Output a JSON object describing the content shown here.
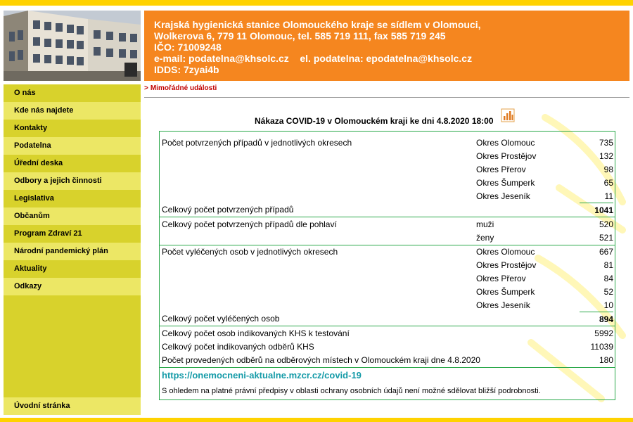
{
  "header": {
    "lines": [
      "Krajská hygienická stanice Olomouckého kraje se sídlem v Olomouci,",
      "Wolkerova 6, 779 11 Olomouc, tel. 585 719 111, fax 585 719 245",
      "IČO: 71009248",
      "e-mail: podatelna@khsolc.cz    el. podatelna: epodatelna@khsolc.cz",
      "IDDS: 7zyai4b"
    ],
    "bg_color": "#f5861f"
  },
  "sidebar": {
    "items": [
      {
        "label": "O nás"
      },
      {
        "label": "Kde nás najdete"
      },
      {
        "label": "Kontakty"
      },
      {
        "label": "Podatelna"
      },
      {
        "label": "Úřední deska"
      },
      {
        "label": "Odbory a jejich činnosti"
      },
      {
        "label": "Legislativa"
      },
      {
        "label": "Občanům"
      },
      {
        "label": "Program Zdraví 21"
      },
      {
        "label": "Národní pandemický plán"
      },
      {
        "label": "Aktuality"
      },
      {
        "label": "Odkazy"
      }
    ],
    "home_label": "Úvodní stránka"
  },
  "breadcrumb": {
    "arrow": ">",
    "label": "Mimořádné události"
  },
  "report": {
    "title": "Nákaza COVID-19 v Olomouckém kraji ke dni 4.8.2020 18:00",
    "icon": "bar-chart-icon",
    "confirmed": {
      "label": "Počet potvrzených případů v jednotlivých okresech",
      "rows": [
        {
          "district": "Okres Olomouc",
          "value": "735"
        },
        {
          "district": "Okres Prostějov",
          "value": "132"
        },
        {
          "district": "Okres Přerov",
          "value": "98"
        },
        {
          "district": "Okres Šumperk",
          "value": "65"
        },
        {
          "district": "Okres Jeseník",
          "value": "11"
        }
      ],
      "total_label": "Celkový počet potvrzených případů",
      "total": "1041"
    },
    "gender": {
      "label": "Celkový počet potvrzených případů dle pohlaví",
      "rows": [
        {
          "name": "muži",
          "value": "520"
        },
        {
          "name": "ženy",
          "value": "521"
        }
      ]
    },
    "recovered": {
      "label": "Počet vyléčených osob v jednotlivých okresech",
      "rows": [
        {
          "district": "Okres Olomouc",
          "value": "667"
        },
        {
          "district": "Okres Prostějov",
          "value": "81"
        },
        {
          "district": "Okres Přerov",
          "value": "84"
        },
        {
          "district": "Okres Šumperk",
          "value": "52"
        },
        {
          "district": "Okres Jeseník",
          "value": "10"
        }
      ],
      "total_label": "Celkový počet vyléčených osob",
      "total": "894"
    },
    "tests": [
      {
        "label": "Celkový počet osob indikovaných KHS k testování",
        "value": "5992"
      },
      {
        "label": "Celkový počet indikovaných odběrů KHS",
        "value": "11039"
      },
      {
        "label": "Počet provedených odběrů na odběrových místech v Olomouckém kraji dne 4.8.2020",
        "value": "180"
      }
    ],
    "link": "https://onemocneni-aktualne.mzcr.cz/covid-19",
    "note": "S ohledem na platné právní předpisy v oblasti ochrany osobních údajů není možné sdělovat bližší podrobnosti."
  }
}
